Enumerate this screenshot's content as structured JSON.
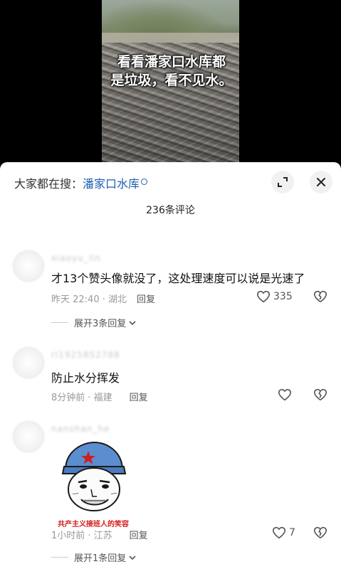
{
  "video": {
    "caption_line1": "看看潘家口水库都",
    "caption_line2": "是垃圾，看不见水。"
  },
  "sheet": {
    "search_prefix": "大家都在搜：",
    "search_keyword": "潘家口水库",
    "comment_count": "236条评论"
  },
  "comments": [
    {
      "username": "xiaoyu_lin",
      "text": "才13个赞头像就没了，这处理速度可以说是光速了",
      "time_location": "昨天 22:40 · 湖北",
      "reply_label": "回复",
      "likes": "335",
      "expand_label": "展开3条回复"
    },
    {
      "username": "ri1925852788",
      "text": "防止水分挥发",
      "time_location": "8分钟前 · 福建",
      "reply_label": "回复",
      "likes": ""
    },
    {
      "username": "nanshan_he",
      "sticker_caption": "共产主义接班人的笑容",
      "time_location": "1小时前 · 江苏",
      "reply_label": "回复",
      "likes": "7",
      "expand_label": "展开1条回复"
    }
  ],
  "colors": {
    "keyword_blue": "#1f5fb0",
    "sticker_red": "#d21c1c",
    "cap_blue": "#5b8ecf"
  }
}
